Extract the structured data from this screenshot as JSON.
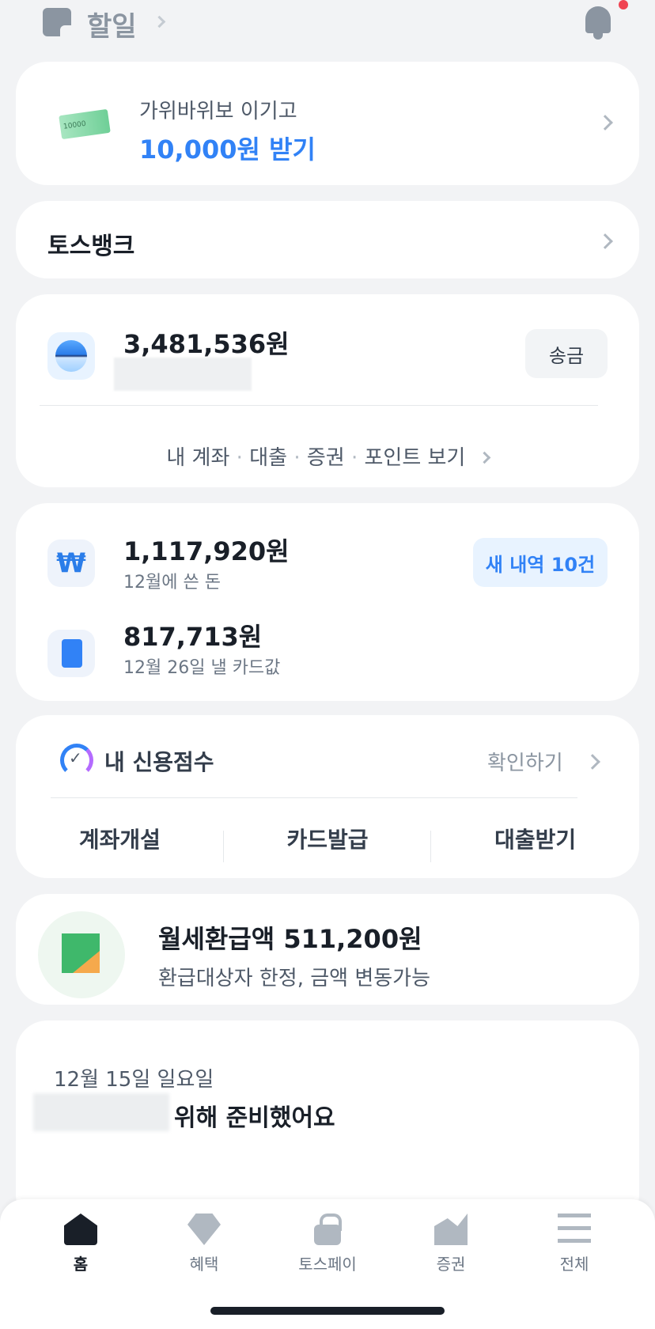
{
  "header": {
    "title": "할일"
  },
  "promo": {
    "subtitle": "가위바위보 이기고",
    "title": "10,000원 받기",
    "money_text": "10000"
  },
  "bank_section": {
    "title": "토스뱅크"
  },
  "account": {
    "balance": "3,481,536원",
    "send_label": "송금",
    "links": [
      "내 계좌",
      "대출",
      "증권",
      "포인트 보기"
    ]
  },
  "spending": {
    "spent_amount": "1,117,920원",
    "spent_label": "12월에 쓴 돈",
    "new_label": "새 내역 10건",
    "card_amount": "817,713원",
    "card_label": "12월 26일 낼 카드값"
  },
  "credit": {
    "title": "내 신용점수",
    "check_label": "확인하기",
    "actions": [
      "계좌개설",
      "카드발급",
      "대출받기"
    ]
  },
  "refund": {
    "title": "월세환급액 511,200원",
    "subtitle": "환급대상자 한정, 금액 변동가능"
  },
  "feed": {
    "date": "12월 15일 일요일",
    "headline": "위해 준비했어요"
  },
  "nav": {
    "tabs": [
      "홈",
      "혜택",
      "토스페이",
      "증권",
      "전체"
    ]
  },
  "colors": {
    "accent": "#3182f6",
    "background": "#f2f3f5",
    "badge": "#f04452"
  }
}
